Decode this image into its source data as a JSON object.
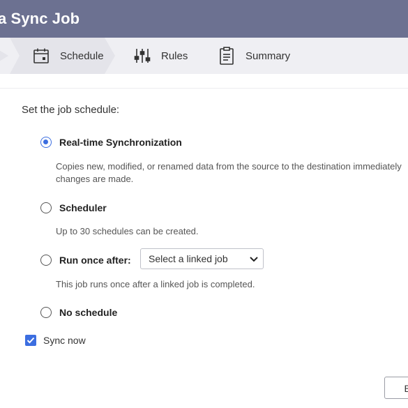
{
  "window": {
    "title": "a Sync Job"
  },
  "steps": [
    {
      "label": "Schedule",
      "icon": "calendar-icon",
      "active": true
    },
    {
      "label": "Rules",
      "icon": "sliders-icon",
      "active": false
    },
    {
      "label": "Summary",
      "icon": "clipboard-icon",
      "active": false
    }
  ],
  "main": {
    "heading": "Set the job schedule:",
    "options": [
      {
        "label": "Real-time Synchronization",
        "selected": true,
        "desc1": "Copies new, modified, or renamed data from the source to the destination immediately",
        "desc2": "changes are made."
      },
      {
        "label": "Scheduler",
        "selected": false,
        "desc1": "Up to 30 schedules can be created."
      },
      {
        "label": "Run once after:",
        "selected": false,
        "desc1": "This job runs once after a linked job is completed."
      },
      {
        "label": "No schedule",
        "selected": false
      }
    ],
    "linked_job_select": {
      "value": "Select a linked job"
    },
    "sync_now": {
      "label": "Sync now",
      "checked": true
    }
  },
  "footer": {
    "back_label": "Ba"
  },
  "colors": {
    "titlebar": "#6c7191",
    "accent": "#3c6ee0"
  }
}
